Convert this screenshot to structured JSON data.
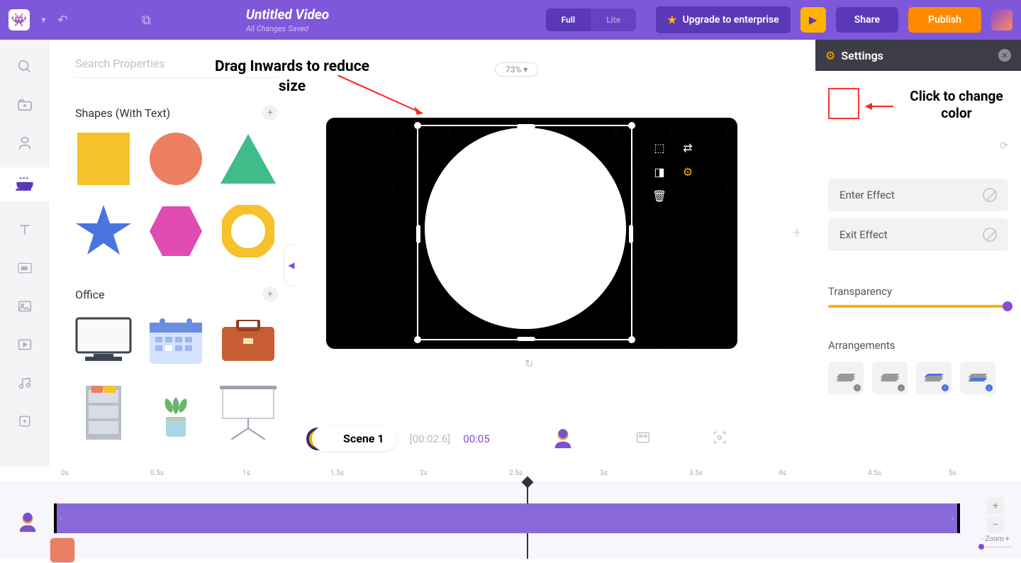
{
  "top": {
    "logo": "👾",
    "title": "Untitled Video",
    "save_status": "All Changes Saved",
    "full_label": "Full",
    "lite_label": "Lite",
    "upgrade_label": "Upgrade to enterprise",
    "share_label": "Share",
    "publish_label": "Publish"
  },
  "panel": {
    "search_placeholder": "Search Properties",
    "cat1": "Shapes (With Text)",
    "cat2": "Office"
  },
  "canvas": {
    "ann_drag": "Drag Inwards to reduce size",
    "zoom": "73%",
    "scene_name": "Scene 1",
    "time_current": "[00:02.6]",
    "time_total": "00:05"
  },
  "settings": {
    "title": "Settings",
    "ann_color": "Click to change color",
    "enter_effect": "Enter Effect",
    "exit_effect": "Exit Effect",
    "transparency": "Transparency",
    "arrangements": "Arrangements"
  },
  "timeline": {
    "ticks": [
      "0s",
      "0.5s",
      "1s",
      "1.5s",
      "2s",
      "2.5s",
      "3s",
      "3.5s",
      "4s",
      "4.5s",
      "5s"
    ],
    "zoom_label": "Zoom"
  }
}
